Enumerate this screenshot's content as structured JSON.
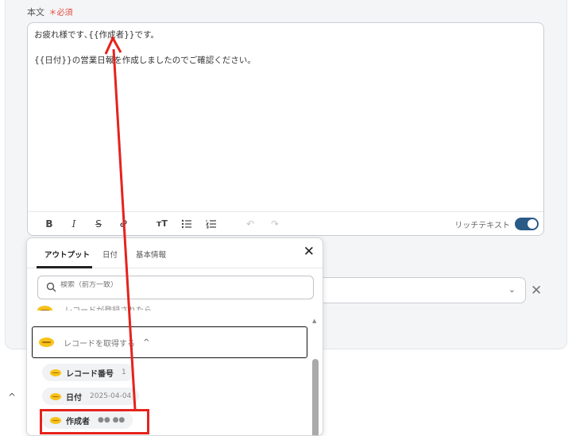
{
  "body_field": {
    "label": "本文",
    "required": "＊必須",
    "line1": "お疲れ様です､{{作成者}}です。",
    "line2": "{{日付}}の営業日報を作成しましたのでご確認ください。"
  },
  "toolbar": {
    "bold": "B",
    "italic": "I",
    "strike": "S",
    "link": "🔗",
    "text_size": "ᴛT",
    "bullet_list": "☰",
    "numbered_list": "☷",
    "undo": "↶",
    "redo": "↷",
    "rich_text_label": "リッチテキスト"
  },
  "popup": {
    "tabs": [
      "アウトプット",
      "日付",
      "基本情報"
    ],
    "close": "✕",
    "search_placeholder": "検索（前方一致）",
    "partial_row_label": "レコードが登録されたら",
    "section_label": "レコードを取得する",
    "section_caret": "^",
    "outputs": [
      {
        "name": "レコード番号",
        "value": "1"
      },
      {
        "name": "日付",
        "value": "2025-04-04"
      },
      {
        "name": "作成者",
        "value": "●● ●●"
      }
    ]
  },
  "background": {
    "select_chevron": "⌄",
    "remove": "✕",
    "collapse": "^"
  },
  "colors": {
    "annotation_red": "#e6221c",
    "toggle_on": "#2a5a86",
    "required": "#e0483c",
    "yoom_yellow": "#f7c21a"
  }
}
